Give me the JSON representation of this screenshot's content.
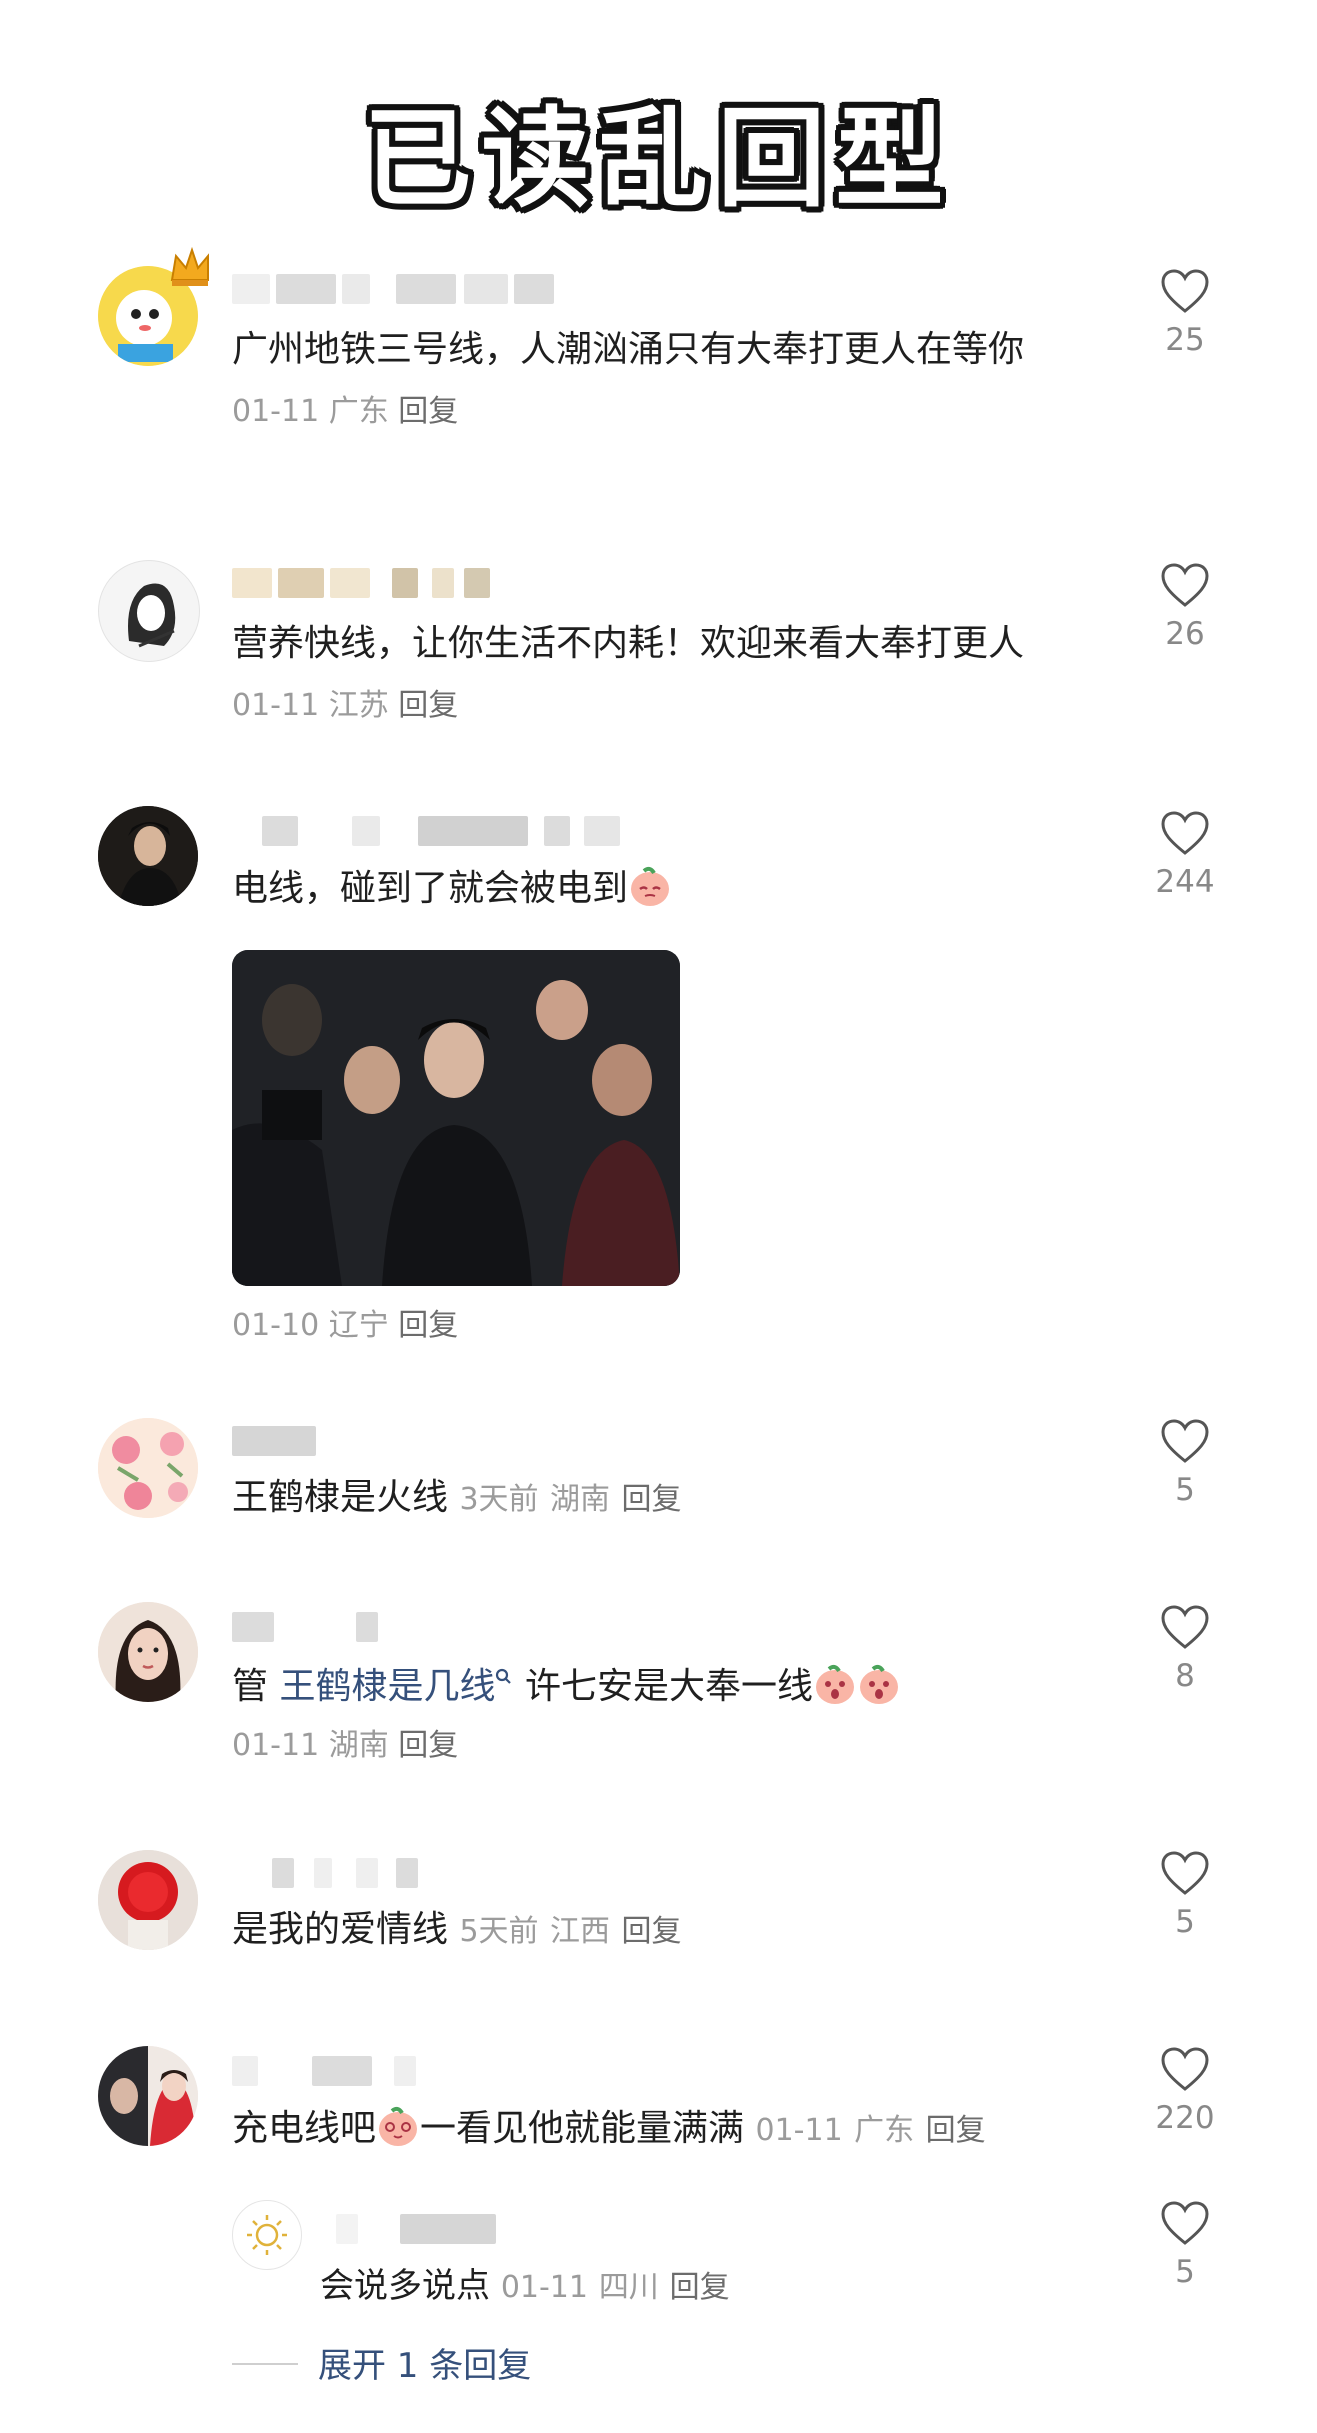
{
  "title": "已读乱回型",
  "comments": [
    {
      "text": "广州地铁三号线，人潮汹涌只有大奉打更人在等你",
      "date": "01-11",
      "location": "广东",
      "reply": "回复",
      "likes": "25",
      "avatar_icon": "cartoon-avatar-icon"
    },
    {
      "text": "营养快线，让你生活不内耗！欢迎来看大奉打更人",
      "date": "01-11",
      "location": "江苏",
      "reply": "回复",
      "likes": "26",
      "avatar_icon": "sketch-avatar-icon"
    },
    {
      "text": "电线，碰到了就会被电到",
      "date": "01-10",
      "location": "辽宁",
      "reply": "回复",
      "likes": "244",
      "avatar_icon": "photo-avatar-icon",
      "image_icon": "event-photo-image"
    },
    {
      "text": "王鹤棣是火线",
      "date": "3天前",
      "location": "湖南",
      "reply": "回复",
      "likes": "5",
      "avatar_icon": "flower-avatar-icon"
    },
    {
      "prefix": "管",
      "link": "王鹤棣是几线",
      "suffix": "许七安是大奉一线",
      "date": "01-11",
      "location": "湖南",
      "reply": "回复",
      "likes": "8",
      "avatar_icon": "portrait-avatar-icon"
    },
    {
      "text": "是我的爱情线",
      "date": "5天前",
      "location": "江西",
      "reply": "回复",
      "likes": "5",
      "avatar_icon": "red-cup-avatar-icon"
    },
    {
      "text_before": "充电线吧",
      "text_after": "一看见他就能量满满",
      "date": "01-11",
      "location": "广东",
      "reply": "回复",
      "likes": "220",
      "avatar_icon": "selfie-avatar-icon"
    }
  ],
  "sub_reply": {
    "text": "会说多说点",
    "date": "01-11",
    "location": "四川",
    "reply": "回复",
    "likes": "5",
    "avatar_icon": "sun-avatar-icon"
  },
  "expand_label": "展开 1 条回复",
  "colors": {
    "link": "#35507b",
    "meta": "#9b9b9b",
    "heart": "#555555"
  }
}
